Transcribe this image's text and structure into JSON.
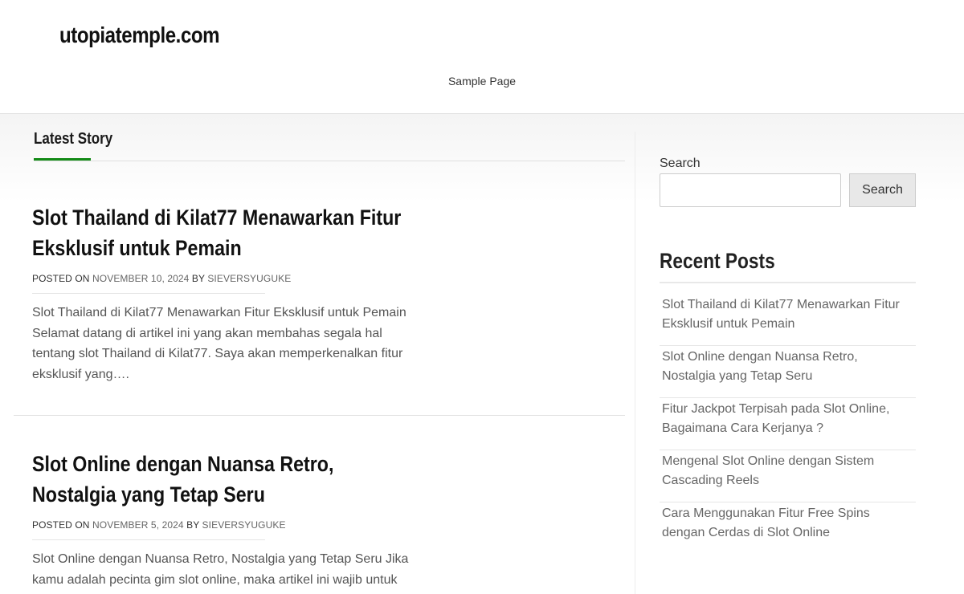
{
  "header": {
    "site_title": "utopiatemple.com",
    "nav_items": [
      "Sample Page"
    ]
  },
  "main": {
    "section_title": "Latest Story",
    "posts": [
      {
        "title": "Slot Thailand di Kilat77 Menawarkan Fitur Eksklusif untuk Pemain",
        "meta_posted_on": "POSTED ON",
        "date": "NOVEMBER 10, 2024",
        "meta_by": "BY",
        "author": "SIEVERSYUGUKE",
        "excerpt": "Slot Thailand di Kilat77 Menawarkan Fitur Eksklusif untuk Pemain Selamat datang di artikel ini yang akan membahas segala hal tentang slot Thailand di Kilat77. Saya akan memperkenalkan fitur eksklusif yang…."
      },
      {
        "title": "Slot Online dengan Nuansa Retro, Nostalgia yang Tetap Seru",
        "meta_posted_on": "POSTED ON",
        "date": "NOVEMBER 5, 2024",
        "meta_by": "BY",
        "author": "SIEVERSYUGUKE",
        "excerpt": "Slot Online dengan Nuansa Retro, Nostalgia yang Tetap Seru Jika kamu adalah pecinta gim slot online, maka artikel ini wajib untuk"
      }
    ]
  },
  "sidebar": {
    "search_label": "Search",
    "search_value": "",
    "search_button": "Search",
    "recent_title": "Recent Posts",
    "recent_posts": [
      "Slot Thailand di Kilat77 Menawarkan Fitur Eksklusif untuk Pemain",
      "Slot Online dengan Nuansa Retro, Nostalgia yang Tetap Seru",
      "Fitur Jackpot Terpisah pada Slot Online, Bagaimana Cara Kerjanya ?",
      "Mengenal Slot Online dengan Sistem Cascading Reels",
      "Cara Menggunakan Fitur Free Spins dengan Cerdas di Slot Online"
    ]
  },
  "colors": {
    "accent": "#138a16",
    "title_text": "#111111",
    "body_text": "#555555"
  }
}
